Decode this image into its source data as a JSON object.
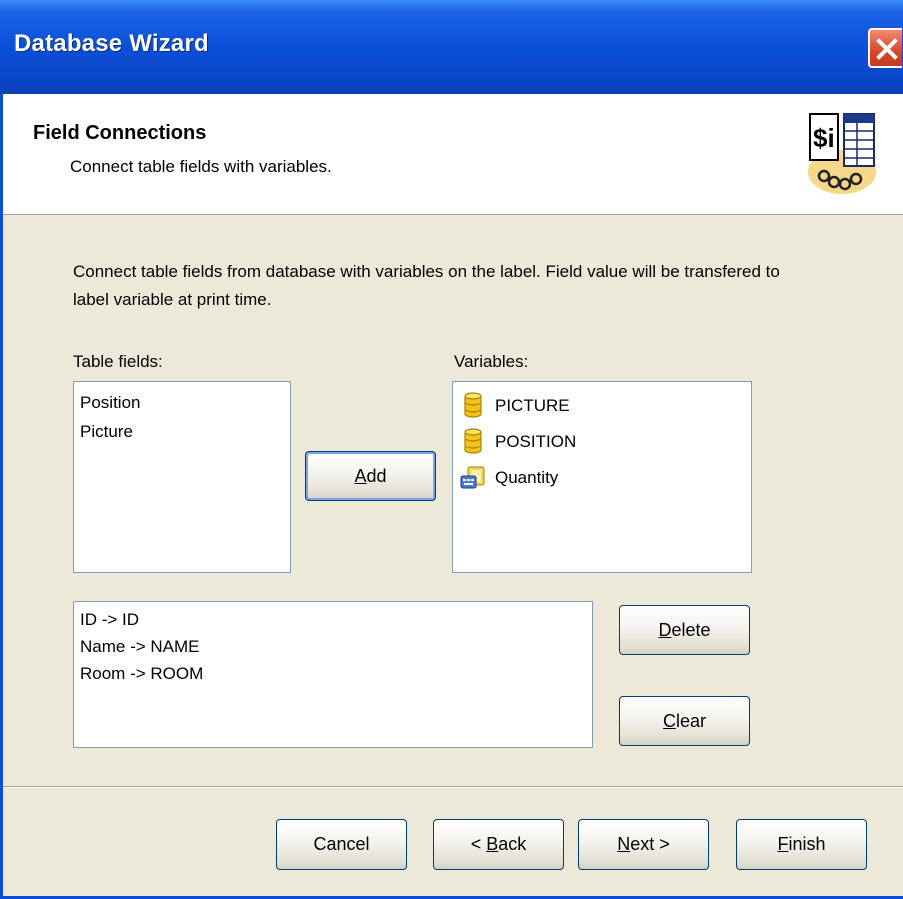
{
  "window": {
    "title": "Database Wizard"
  },
  "header": {
    "title": "Field Connections",
    "subtitle": "Connect table fields with variables."
  },
  "description": "Connect table fields from database with variables on the label. Field value will be transfered to label variable at print time.",
  "table_fields": {
    "label": "Table fields:",
    "items": [
      "Position",
      "Picture"
    ]
  },
  "variables": {
    "label": "Variables:",
    "items": [
      {
        "label": "PICTURE",
        "icon": "database-variable-icon"
      },
      {
        "label": "POSITION",
        "icon": "database-variable-icon"
      },
      {
        "label": "Quantity",
        "icon": "keyboard-variable-icon"
      }
    ]
  },
  "connections": {
    "items": [
      "ID -> ID",
      "Name -> NAME",
      "Room -> ROOM"
    ]
  },
  "buttons": {
    "add": {
      "mnemonic": "A",
      "rest": "dd"
    },
    "delete": {
      "mnemonic": "D",
      "rest": "elete"
    },
    "clear": {
      "mnemonic": "C",
      "rest": "lear"
    },
    "cancel": "Cancel",
    "back": {
      "prefix": "< ",
      "mnemonic": "B",
      "rest": "ack"
    },
    "next": {
      "mnemonic": "N",
      "rest": "ext >"
    },
    "finish": {
      "mnemonic": "F",
      "rest": "inish"
    }
  },
  "colors": {
    "titlebar": "#0b4fd8",
    "dialog_bg": "#ece9d8",
    "close_button": "#d9462b"
  }
}
